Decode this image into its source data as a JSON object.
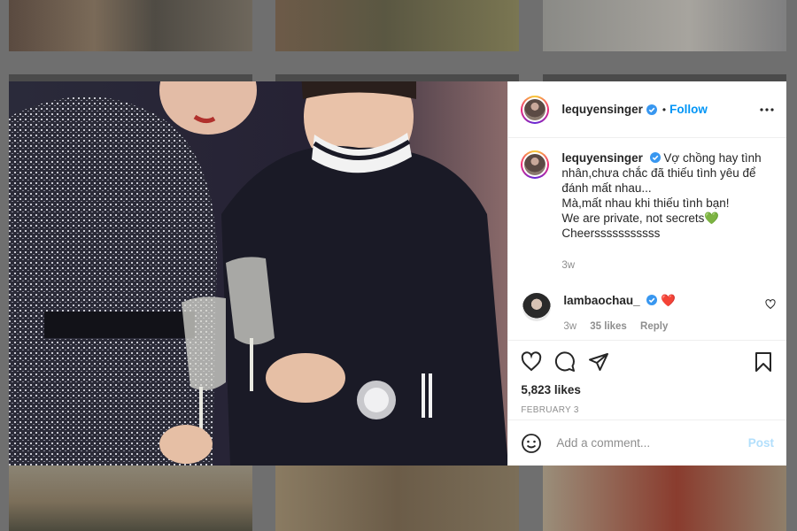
{
  "post": {
    "username": "lequyensinger",
    "follow_label": "Follow",
    "separator": "•"
  },
  "caption": {
    "username": "lequyensinger",
    "lines": [
      "Vợ chồng hay tình nhân,chưa chắc đã thiếu tình yêu để đánh mất nhau...",
      "Mà,mất nhau khi thiếu tình bạn!",
      "We are private, not secrets💚",
      "Cheersssssssssss"
    ],
    "time": "3w"
  },
  "comment": {
    "username": "lambaochau_",
    "text": "❤️",
    "time": "3w",
    "likes": "35 likes",
    "reply_label": "Reply"
  },
  "actions": {
    "likes": "5,823 likes",
    "date": "FEBRUARY 3"
  },
  "composer": {
    "placeholder": "Add a comment...",
    "post_label": "Post"
  },
  "icons": {
    "more": "more-options-icon",
    "like": "heart-icon",
    "comment": "comment-icon",
    "share": "share-icon",
    "save": "bookmark-icon",
    "emoji": "emoji-icon",
    "verified": "verified-badge-icon"
  },
  "colors": {
    "accent": "#0095f6",
    "verified": "#3897f0",
    "muted": "#8e8e8e",
    "post_disabled": "#b2dffc"
  }
}
